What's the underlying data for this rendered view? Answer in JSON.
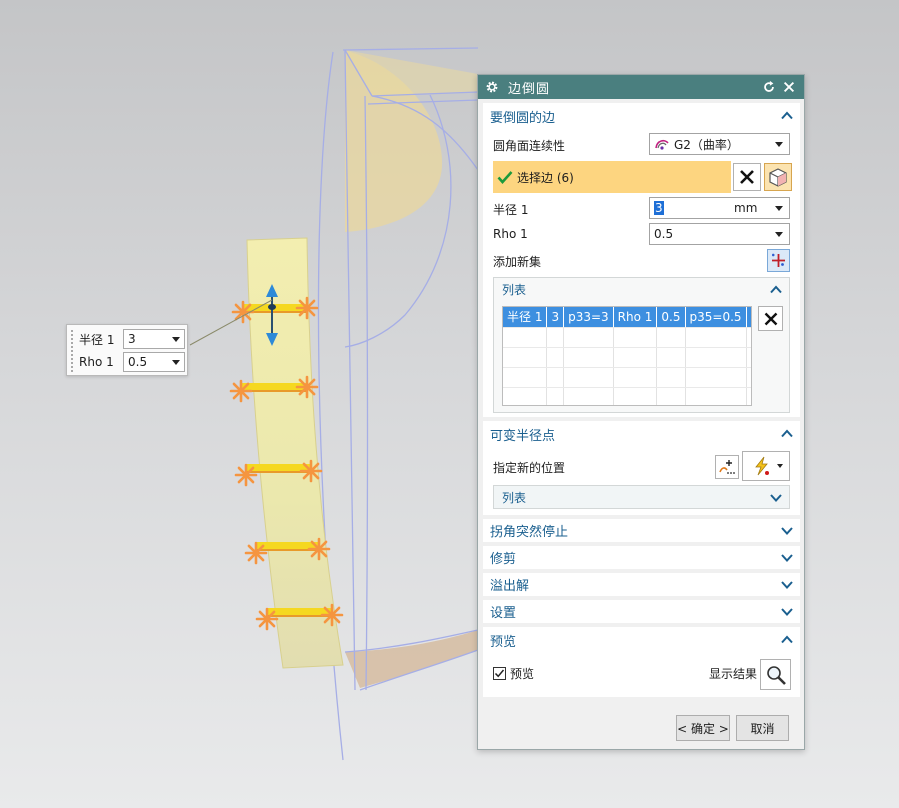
{
  "dialog": {
    "title": "边倒圆",
    "sections": {
      "edges": {
        "title": "要倒圆的边",
        "continuity_label": "圆角面连续性",
        "continuity_value": "G2（曲率）",
        "select_edge_label": "选择边 (6)",
        "radius_label": "半径 1",
        "radius_value": "3",
        "radius_unit": "mm",
        "rho_label": "Rho 1",
        "rho_value": "0.5",
        "add_set_label": "添加新集",
        "list": {
          "title": "列表",
          "rows": [
            [
              "半径 1",
              "3",
              "p33=3",
              "Rho 1",
              "0.5",
              "p35=0.5",
              ""
            ],
            [
              "",
              "",
              "",
              "",
              "",
              "",
              ""
            ],
            [
              "",
              "",
              "",
              "",
              "",
              "",
              ""
            ],
            [
              "",
              "",
              "",
              "",
              "",
              "",
              ""
            ],
            [
              "",
              "",
              "",
              "",
              "",
              "",
              ""
            ]
          ]
        }
      },
      "variable_radius": {
        "title": "可变半径点",
        "specify_location_label": "指定新的位置",
        "list_title": "列表"
      },
      "corner_stop": {
        "title": "拐角突然停止"
      },
      "trim": {
        "title": "修剪"
      },
      "overflow": {
        "title": "溢出解"
      },
      "settings": {
        "title": "设置"
      },
      "preview": {
        "title": "预览",
        "preview_checkbox_label": "预览",
        "preview_checked": true,
        "show_result_label": "显示结果"
      }
    },
    "ok_label": "< 确定 >",
    "cancel_label": "取消"
  },
  "onscreen_input": {
    "radius_label": "半径 1",
    "radius_value": "3",
    "rho_label": "Rho 1",
    "rho_value": "0.5"
  },
  "colors": {
    "title_bar": "#4a7f7f",
    "section_title": "#1a5f8f",
    "selection_highlight": "#fdd580",
    "list_selected_row": "#3d8fe0",
    "edge_marker": "#f59540",
    "edge_highlight": "#f5d820"
  },
  "icons": {
    "title": "gear-icon",
    "reset": "reset-icon",
    "close": "close-icon",
    "continuity": "curvature-icon",
    "select_check": "check-icon",
    "deselect": "x-icon",
    "solid_body": "cube-icon",
    "add_set": "add-set-icon",
    "remove_row": "x-icon",
    "point_dialog": "point-dialog-icon",
    "point_snap": "lightning-point-icon",
    "show_result": "magnifier-icon"
  }
}
